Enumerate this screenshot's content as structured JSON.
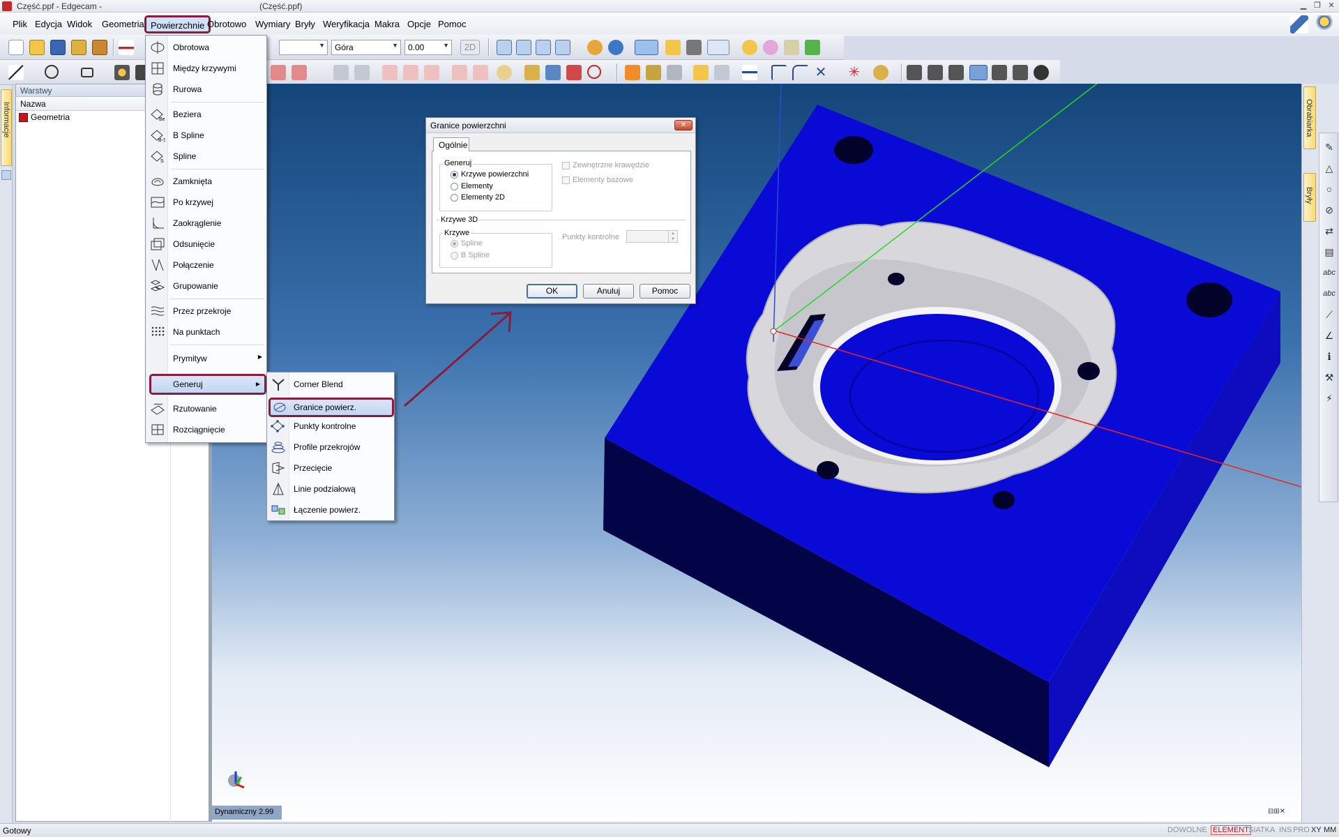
{
  "window": {
    "title_left": "Część.ppf - Edgecam -",
    "title_right": "(Część.ppf)"
  },
  "menubar": {
    "items": [
      "Plik",
      "Edycja",
      "Widok",
      "Geometria",
      "Powierzchnie",
      "Obrotowo",
      "Wymiary",
      "Bryły",
      "Weryfikacja",
      "Makra",
      "Opcje",
      "Pomoc"
    ],
    "active_item": "Powierzchnie"
  },
  "toolbar": {
    "view_combo": "Góra",
    "value_combo": "0.00",
    "mode_button": "2D"
  },
  "left_tab": {
    "label": "Informacje"
  },
  "layers": {
    "title": "Warstwy",
    "column_header": "Nazwa",
    "rows": [
      {
        "name": "Geometria"
      }
    ]
  },
  "surfaces_menu": {
    "items": [
      {
        "label": "Obrotowa",
        "icon": "revolve-surface-icon"
      },
      {
        "label": "Między krzywymi",
        "icon": "between-curves-icon"
      },
      {
        "label": "Rurowa",
        "icon": "tube-surface-icon"
      },
      {
        "label": "Beziera",
        "icon": "bezier-surface-icon"
      },
      {
        "label": "B Spline",
        "icon": "bspline-surface-icon"
      },
      {
        "label": "Spline",
        "icon": "spline-surface-icon"
      },
      {
        "label": "Zamknięta",
        "icon": "closed-surface-icon"
      },
      {
        "label": "Po krzywej",
        "icon": "sweep-surface-icon"
      },
      {
        "label": "Zaokrąglenie",
        "icon": "fillet-surface-icon"
      },
      {
        "label": "Odsunięcie",
        "icon": "offset-surface-icon"
      },
      {
        "label": "Połączenie",
        "icon": "blend-surface-icon"
      },
      {
        "label": "Grupowanie",
        "icon": "group-surface-icon"
      },
      {
        "label": "Przez przekroje",
        "icon": "sections-surface-icon"
      },
      {
        "label": "Na punktach",
        "icon": "points-surface-icon"
      },
      {
        "label": "Prymityw",
        "icon": ""
      },
      {
        "label": "Generuj",
        "icon": "",
        "highlighted": true
      },
      {
        "label": "Rzutowanie",
        "icon": "projection-icon"
      },
      {
        "label": "Rozciągnięcie",
        "icon": "extend-surface-icon"
      }
    ]
  },
  "generate_submenu": {
    "items": [
      {
        "label": "Corner Blend",
        "icon": "corner-blend-icon"
      },
      {
        "label": "Granice powierz.",
        "icon": "surface-boundary-icon",
        "highlighted": true
      },
      {
        "label": "Punkty kontrolne",
        "icon": "control-points-icon"
      },
      {
        "label": "Profile przekrojów",
        "icon": "section-profiles-icon"
      },
      {
        "label": "Przecięcie",
        "icon": "intersection-icon"
      },
      {
        "label": "Linie podziałową",
        "icon": "parting-lines-icon"
      },
      {
        "label": "Łączenie powierz.",
        "icon": "join-surfaces-icon"
      }
    ]
  },
  "dialog": {
    "title": "Granice powierzchni",
    "tab": "Ogólnie",
    "generate_group": "Generuj",
    "generate_options": [
      "Krzywe powierzchni",
      "Elementy",
      "Elementy 2D"
    ],
    "generate_selected": "Krzywe powierzchni",
    "checkbox_outer_edges": "Zewnętrzne krawędzie",
    "checkbox_base_elements": "Elementy bazowe",
    "section_3d": "Krzywe 3D",
    "curves_group": "Krzywe",
    "curve_options": [
      "Spline",
      "B Spline"
    ],
    "curve_selected": "Spline",
    "control_points_label": "Punkty kontrolne",
    "ok_button": "OK",
    "cancel_button": "Anuluj",
    "help_button": "Pomoc"
  },
  "right_panel": {
    "tab1": "Obrabiarka",
    "tab2": "Bryły"
  },
  "viewport": {
    "dynamic_label": "Dynamiczny 2.99",
    "model_color": "#0a0ad6",
    "model_side_color": "#020242"
  },
  "statusbar": {
    "status": "Gotowy",
    "indicators": [
      "DOWOLNE",
      "ELEMENT",
      "SIATKA",
      "INS",
      "PRO",
      "XY",
      "MM"
    ],
    "active_indicator": "ELEMENT"
  },
  "colors": {
    "highlight_border": "#8b1a3d",
    "menu_hover": "#c3d6f2"
  }
}
